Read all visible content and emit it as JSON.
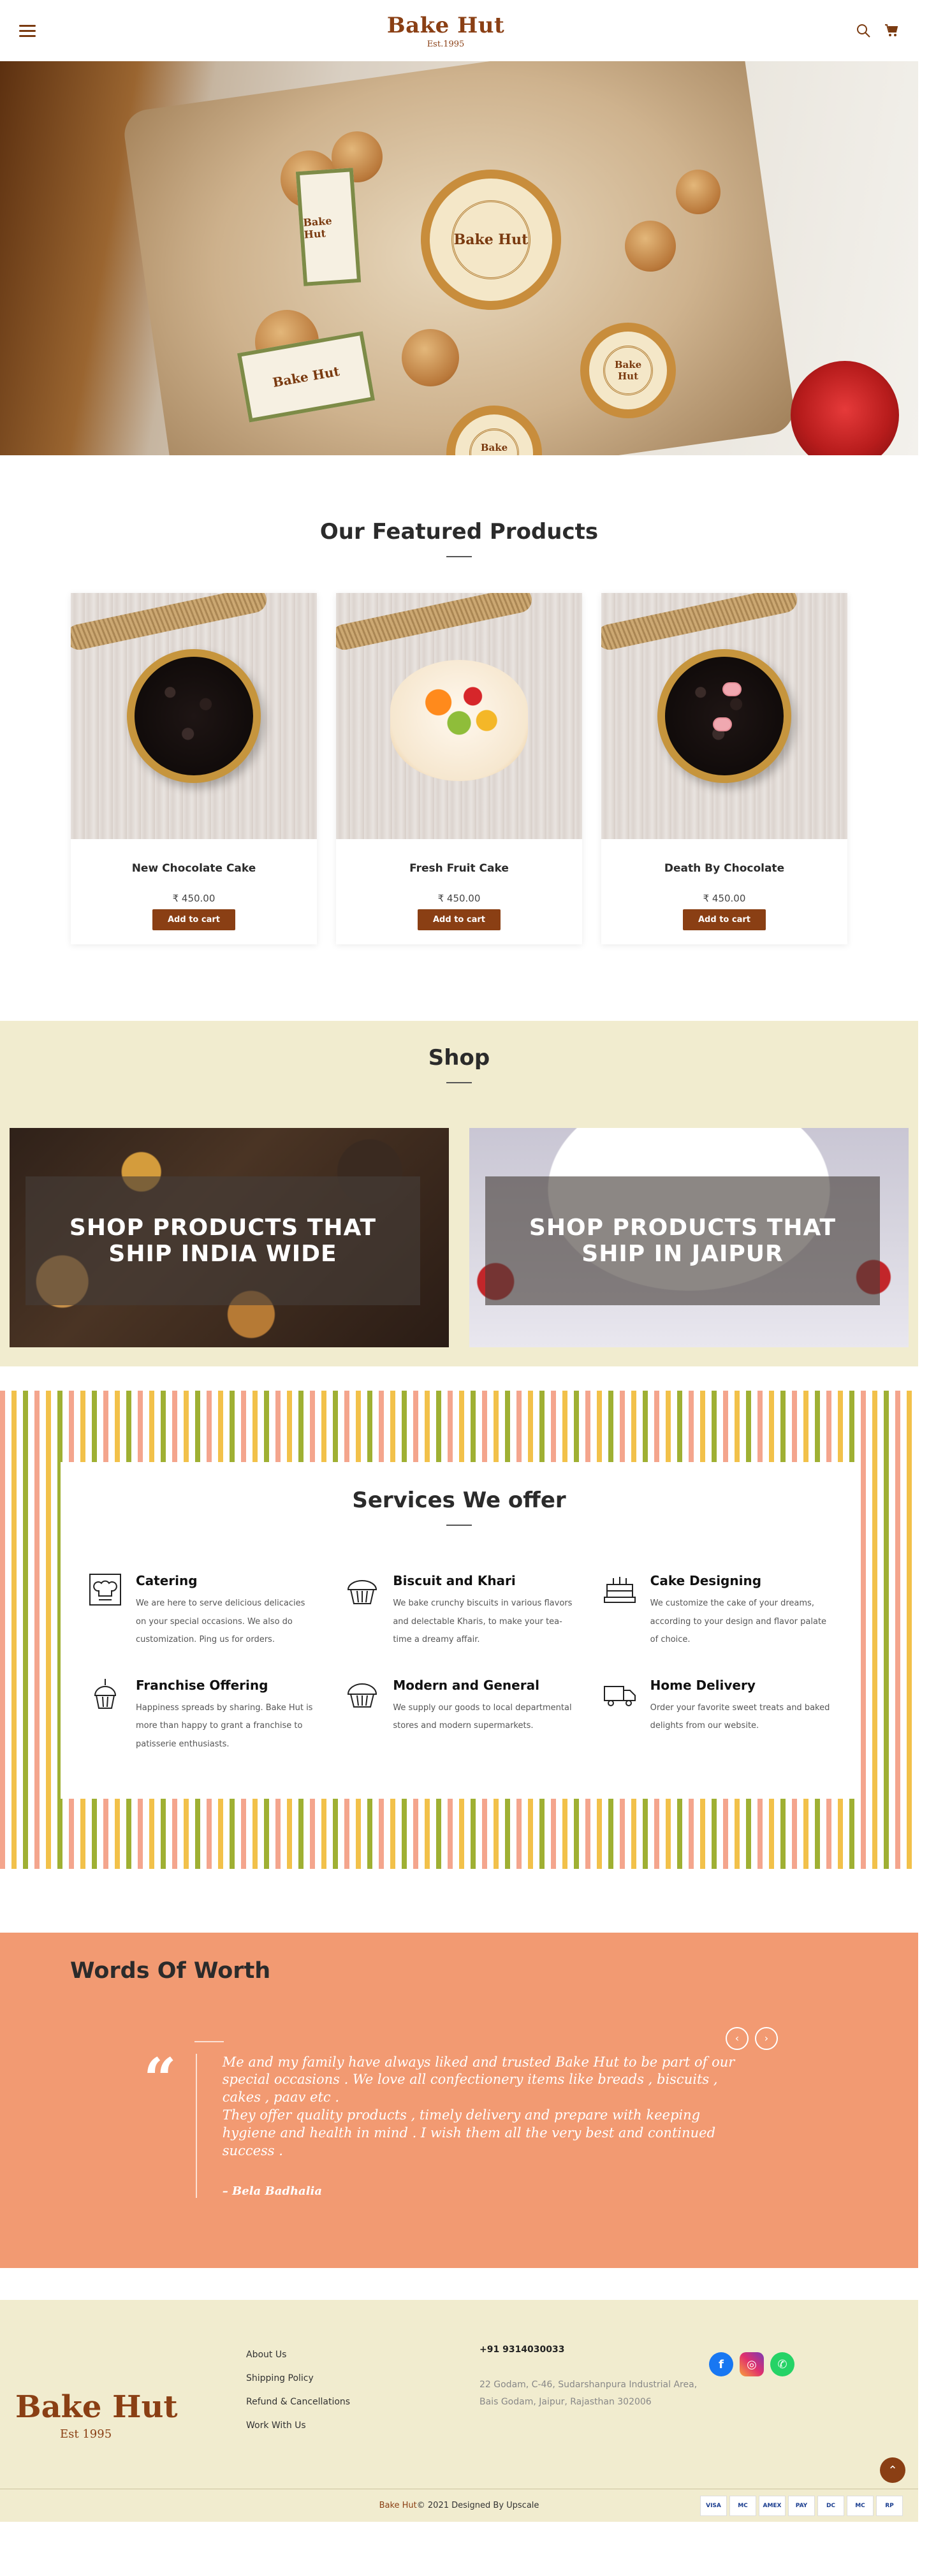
{
  "brand": {
    "name": "Bake Hut",
    "est": "Est.1995",
    "footer_est": "Est 1995",
    "color": "#8a3f14"
  },
  "header": {
    "menu_icon": "hamburger-icon",
    "search_icon": "search-icon",
    "cart_icon": "cart-icon"
  },
  "featured": {
    "title": "Our Featured Products",
    "products": [
      {
        "name": "New Chocolate Cake",
        "price": "₹ 450.00",
        "cta": "Add to cart"
      },
      {
        "name": "Fresh Fruit Cake",
        "price": "₹ 450.00",
        "cta": "Add to cart"
      },
      {
        "name": "Death By Chocolate",
        "price": "₹ 450.00",
        "cta": "Add to cart"
      }
    ]
  },
  "shop": {
    "title": "Shop",
    "tiles": [
      {
        "label": "SHOP PRODUCTS THAT SHIP INDIA WIDE"
      },
      {
        "label": "SHOP PRODUCTS THAT SHIP IN JAIPUR"
      }
    ]
  },
  "services": {
    "title": "Services We offer",
    "items": [
      {
        "title": "Catering",
        "icon": "chef-hat-icon",
        "desc": "We are here to serve delicious delicacies on your special occasions. We also do customization. Ping us for orders."
      },
      {
        "title": "Biscuit and Khari",
        "icon": "cupcake-icon",
        "desc": "We bake crunchy biscuits in various flavors and delectable Kharis, to make your tea-time a dreamy affair."
      },
      {
        "title": "Cake Designing",
        "icon": "layer-cake-icon",
        "desc": "We customize the cake of your dreams, according to your design and flavor palate of choice."
      },
      {
        "title": "Franchise Offering",
        "icon": "cupcake-candle-icon",
        "desc": "Happiness spreads by sharing. Bake Hut is more than happy to grant a franchise to patisserie enthusiasts."
      },
      {
        "title": "Modern and General",
        "icon": "muffin-icon",
        "desc": "We supply our goods to local departmental stores and modern supermarkets."
      },
      {
        "title": "Home Delivery",
        "icon": "delivery-truck-icon",
        "desc": "Order your favorite sweet treats and baked delights from our website."
      }
    ]
  },
  "testimonials": {
    "title": "Words Of Worth",
    "prev": "‹",
    "next": "›",
    "quote": "Me and my family have always liked and trusted Bake Hut to be part of our special occasions . We love all confectionery items like breads , biscuits , cakes , paav etc .\nThey offer quality products , timely delivery and prepare with keeping hygiene and health in mind . I wish them all the very best and continued success .",
    "author": "– Bela Badhalia"
  },
  "footer": {
    "links": [
      "About Us",
      "Shipping Policy",
      "Refund & Cancellations",
      "Work With Us"
    ],
    "phone": "+91 9314030033",
    "address": "22 Godam, C-46, Sudarshanpura Industrial Area, Bais Godam, Jaipur, Rajasthan 302006",
    "social": [
      "facebook-icon",
      "instagram-icon",
      "whatsapp-icon"
    ],
    "copyright_brand": "Bake Hut",
    "copyright_rest": " © 2021 Designed By Upscale",
    "payments": [
      "VISA",
      "MC",
      "AMEX",
      "PAY",
      "DC",
      "MC",
      "RP"
    ]
  },
  "colors": {
    "accent": "#8a3f14",
    "cream": "#f1eccf",
    "salmon": "#f29a72"
  }
}
